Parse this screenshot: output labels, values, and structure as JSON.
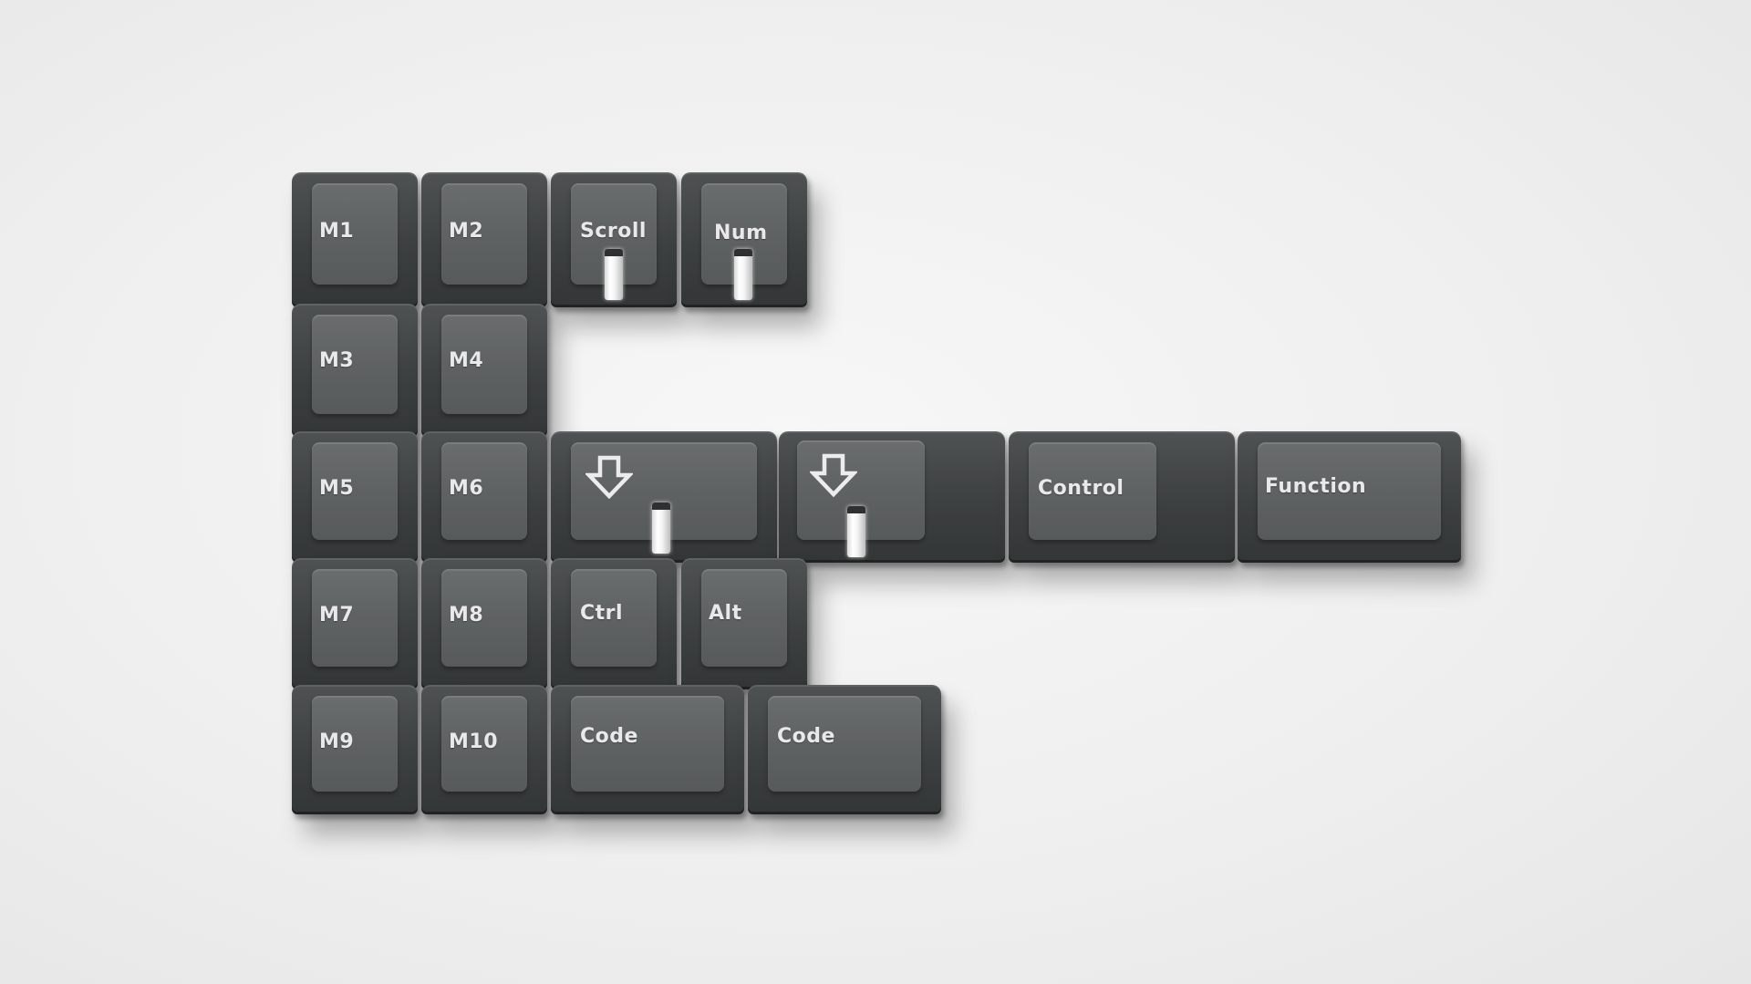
{
  "keys": {
    "m1": "M1",
    "m2": "M2",
    "scroll": "Scroll",
    "num": "Num",
    "m3": "M3",
    "m4": "M4",
    "m5": "M5",
    "m6": "M6",
    "control": "Control",
    "function": "Function",
    "m7": "M7",
    "m8": "M8",
    "ctrl": "Ctrl",
    "alt": "Alt",
    "m9": "M9",
    "m10": "M10",
    "code1": "Code",
    "code2": "Code"
  },
  "icons": {
    "arrow_down": "arrow-down-outline-icon"
  },
  "colors": {
    "background": "#efefef",
    "keycap_side": "#3d4041",
    "keycap_top": "#5f6263",
    "legend": "#e9e9e9",
    "indicator": "#ffffff"
  }
}
